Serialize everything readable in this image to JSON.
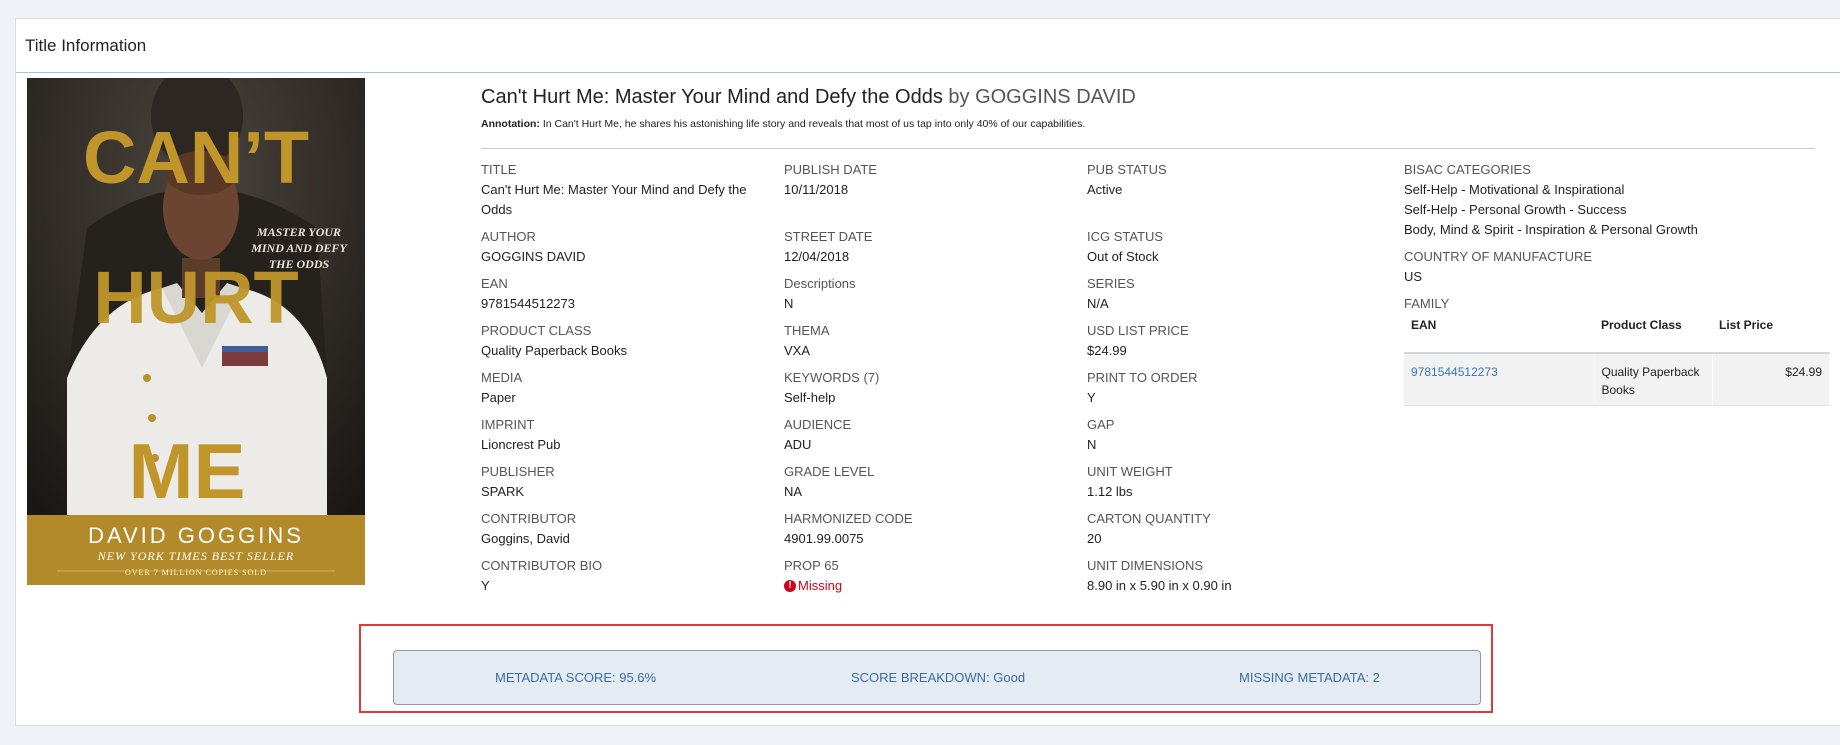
{
  "panel": {
    "title": "Title Information"
  },
  "cover": {
    "line1": "CAN’T",
    "line2": "HURT",
    "line3": "ME",
    "tagline": [
      "MASTER YOUR",
      "MIND AND DEFY",
      "THE ODDS"
    ],
    "author": "DAVID GOGGINS",
    "subtitle": "NEW YORK TIMES BEST SELLER",
    "copies": "OVER 7 MILLION COPIES SOLD",
    "gold": "#c0962a"
  },
  "book": {
    "title": "Can't Hurt Me: Master Your Mind and Defy the Odds",
    "by": "by GOGGINS DAVID",
    "annotation_label": "Annotation:",
    "annotation_text": "In Can't Hurt Me, he shares his astonishing life story and reveals that most of us tap into only 40% of our capabilities."
  },
  "columns": {
    "c1": [
      {
        "label": "TITLE",
        "value": "Can't Hurt Me: Master Your Mind and Defy the Odds"
      },
      {
        "label": "AUTHOR",
        "value": "GOGGINS DAVID"
      },
      {
        "label": "EAN",
        "value": "9781544512273"
      },
      {
        "label": "PRODUCT CLASS",
        "value": "Quality Paperback Books"
      },
      {
        "label": "MEDIA",
        "value": "Paper"
      },
      {
        "label": "IMPRINT",
        "value": "Lioncrest Pub"
      },
      {
        "label": "PUBLISHER",
        "value": "SPARK"
      },
      {
        "label": "CONTRIBUTOR",
        "value": "Goggins, David"
      },
      {
        "label": "CONTRIBUTOR BIO",
        "value": "Y"
      }
    ],
    "c2": [
      {
        "label": "PUBLISH DATE",
        "value": "10/11/2018"
      },
      {
        "label": "STREET DATE",
        "value": "12/04/2018"
      },
      {
        "label": "Descriptions",
        "value": "N"
      },
      {
        "label": "THEMA",
        "value": "VXA"
      },
      {
        "label": "KEYWORDS (7)",
        "value": "Self-help"
      },
      {
        "label": "AUDIENCE",
        "value": "ADU"
      },
      {
        "label": "GRADE LEVEL",
        "value": "NA"
      },
      {
        "label": "HARMONIZED CODE",
        "value": "4901.99.0075"
      },
      {
        "label": "PROP 65",
        "value": "Missing"
      }
    ],
    "c3": [
      {
        "label": "PUB STATUS",
        "value": "Active"
      },
      {
        "label": "ICG STATUS",
        "value": "Out of Stock"
      },
      {
        "label": "SERIES",
        "value": "N/A"
      },
      {
        "label": "USD LIST PRICE",
        "value": "$24.99"
      },
      {
        "label": "PRINT TO ORDER",
        "value": "Y"
      },
      {
        "label": "GAP",
        "value": "N"
      },
      {
        "label": "UNIT WEIGHT",
        "value": "1.12 lbs"
      },
      {
        "label": "CARTON QUANTITY",
        "value": "20"
      },
      {
        "label": "UNIT DIMENSIONS",
        "value": "8.90 in x 5.90 in x 0.90 in"
      }
    ]
  },
  "right": {
    "bisac_label": "BISAC CATEGORIES",
    "bisac": [
      "Self-Help - Motivational & Inspirational",
      "Self-Help - Personal Growth - Success",
      "Body, Mind & Spirit - Inspiration & Personal Growth"
    ],
    "country_label": "COUNTRY OF MANUFACTURE",
    "country": "US",
    "family_label": "FAMILY",
    "family_headers": [
      "EAN",
      "Product Class",
      "List Price"
    ],
    "family_rows": [
      {
        "ean": "9781544512273",
        "product_class": "Quality Paperback Books",
        "list_price": "$24.99"
      }
    ]
  },
  "score": {
    "metadata_score": "METADATA SCORE: 95.6%",
    "breakdown": "SCORE BREAKDOWN: Good",
    "missing": "MISSING METADATA: 2",
    "highlight_color": "#e0393a"
  }
}
